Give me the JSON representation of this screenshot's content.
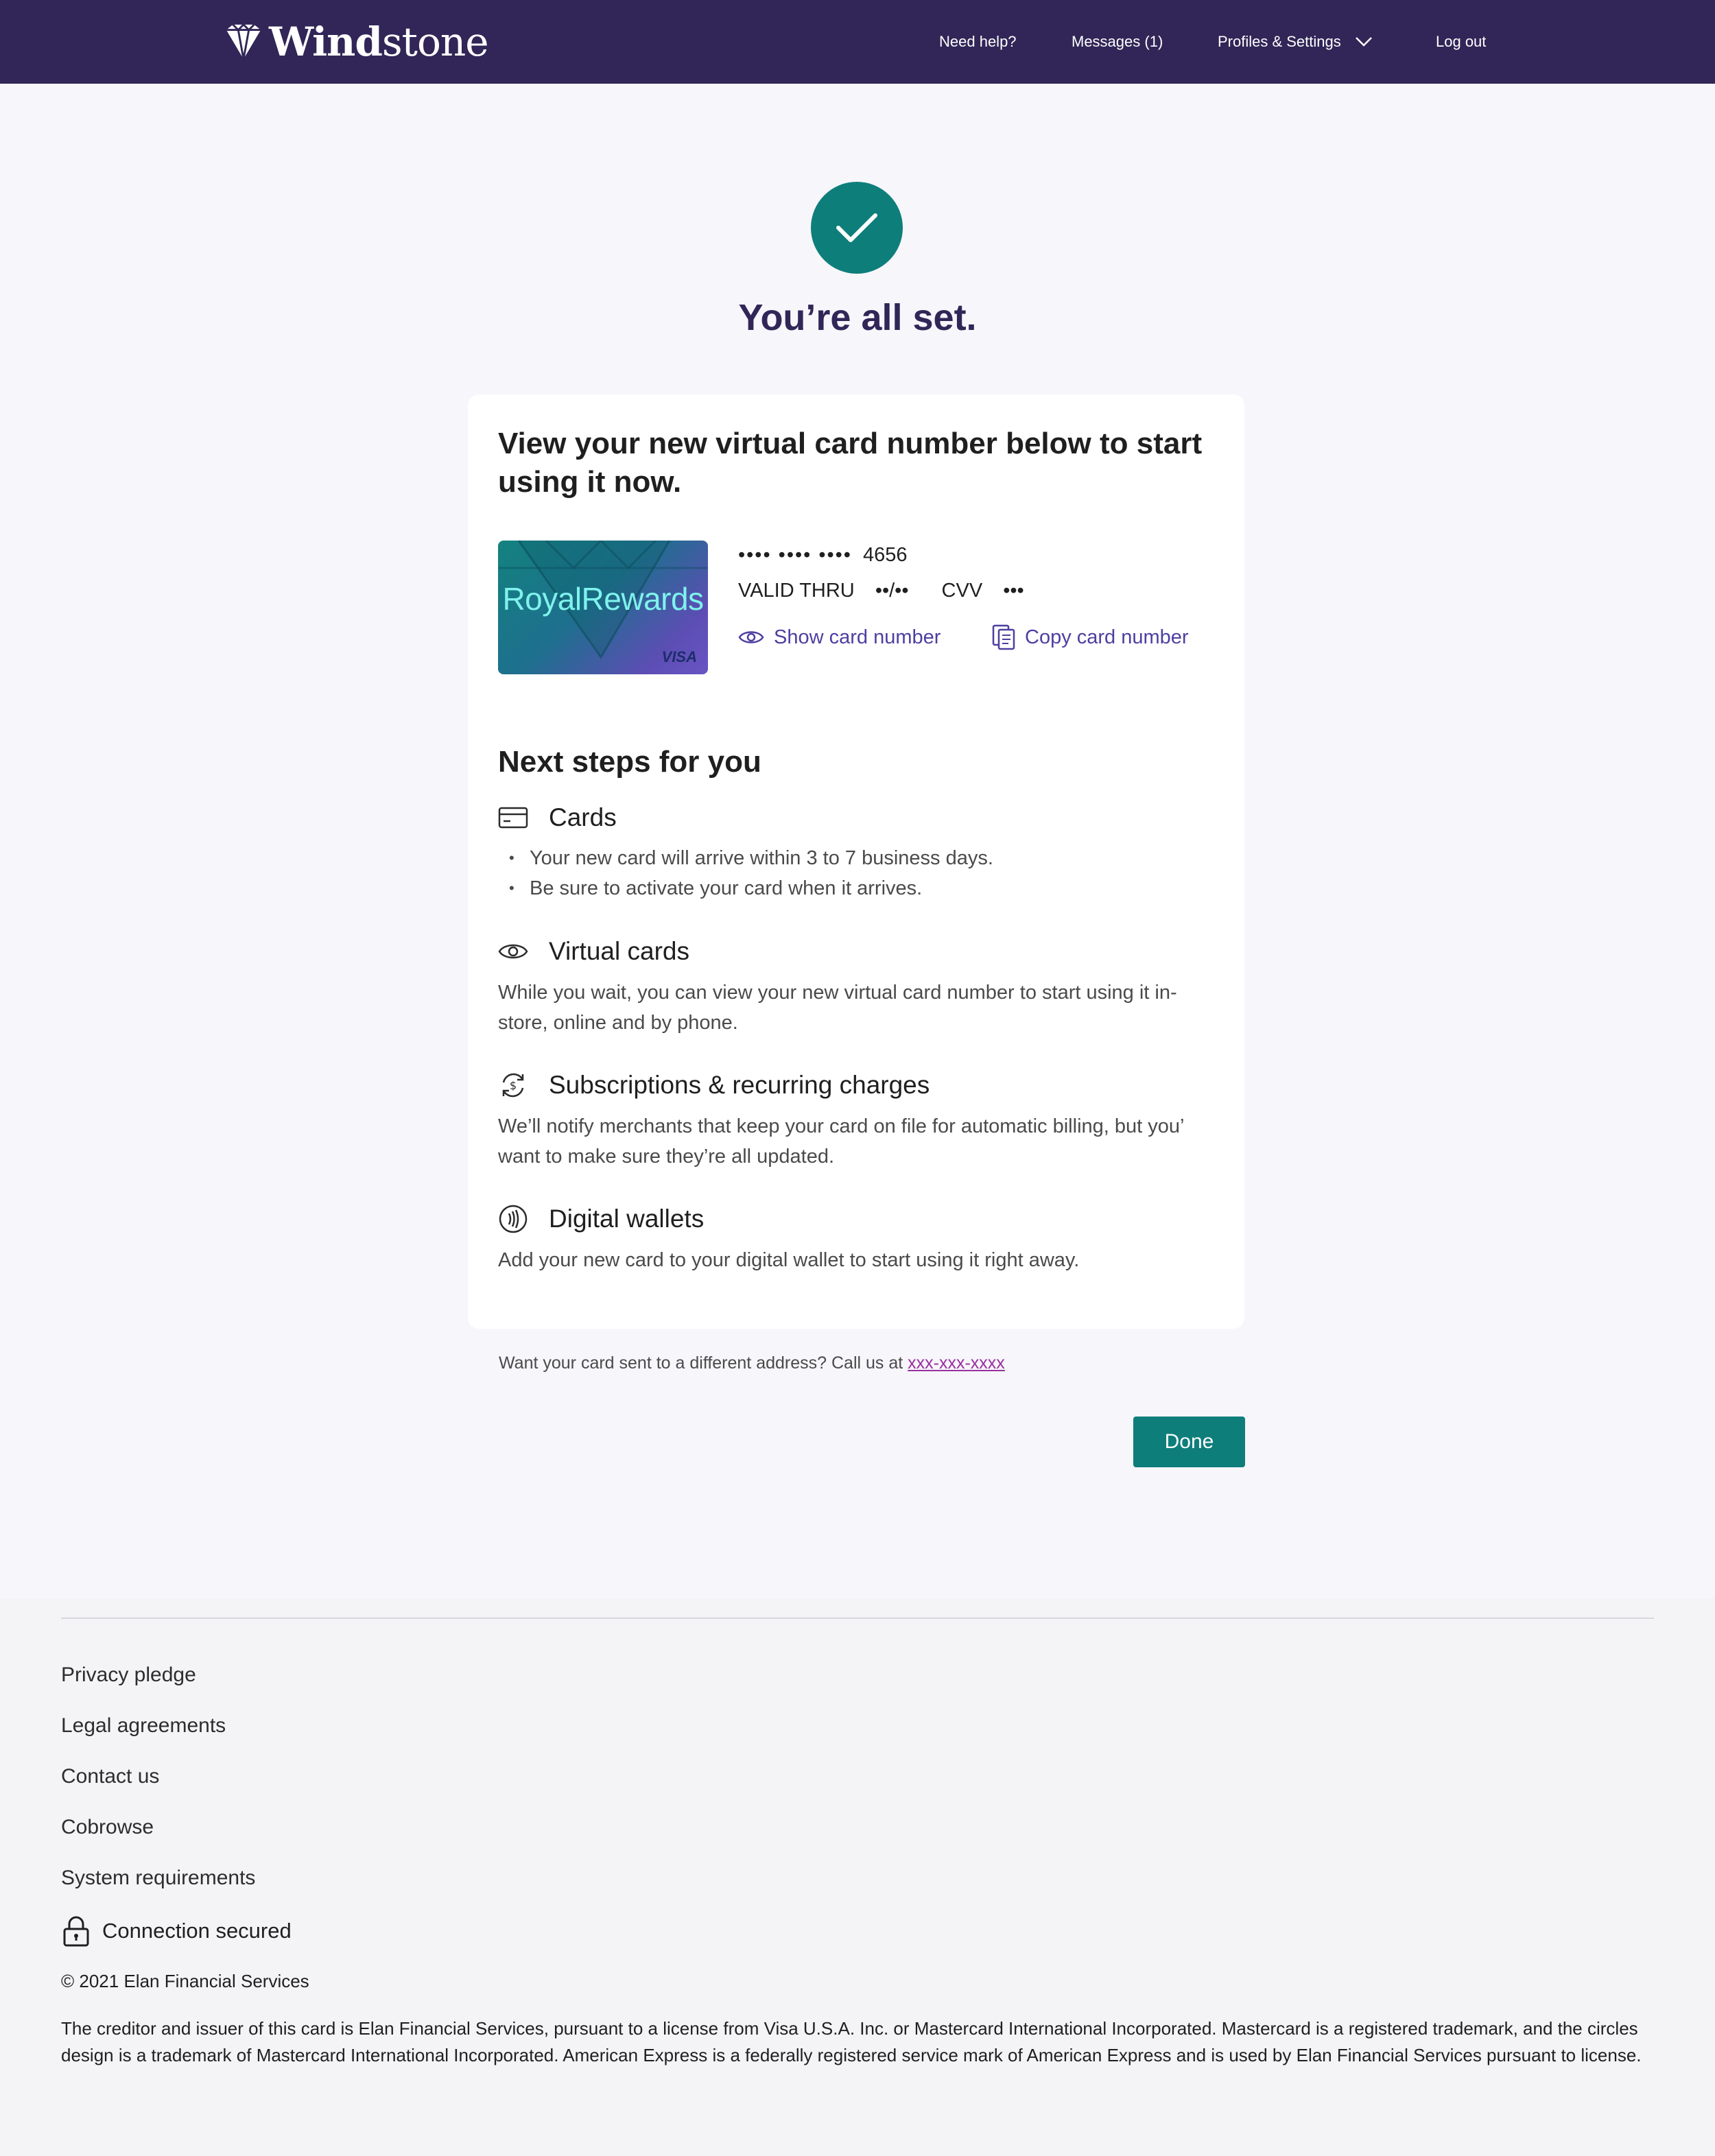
{
  "header": {
    "brand_bold": "Wind",
    "brand_light": "stone",
    "nav": {
      "help": "Need help?",
      "messages": "Messages (1)",
      "profiles": "Profiles & Settings",
      "logout": "Log out"
    }
  },
  "success": {
    "title": "You’re all set."
  },
  "card": {
    "heading": "View your new virtual card number below to start using it now.",
    "art_brand": "RoyalRewards",
    "art_network": "VISA",
    "masked_number": "•••• •••• ••••",
    "last_four": "4656",
    "valid_label": "VALID THRU",
    "valid_value": "••/••",
    "cvv_label": "CVV",
    "cvv_value": "•••",
    "show_link": "Show card number",
    "copy_link": "Copy card number"
  },
  "next_steps": {
    "title": "Next steps for you",
    "cards": {
      "heading": "Cards",
      "bullets": [
        "Your new card will arrive within 3 to 7 business days.",
        "Be sure to activate your card when it arrives."
      ]
    },
    "virtual": {
      "heading": "Virtual cards",
      "text": "While you wait, you can view your new virtual card number to start using it in-store, online and by phone."
    },
    "subscriptions": {
      "heading": "Subscriptions & recurring charges",
      "text": "We’ll notify merchants that keep your card on file for automatic billing, but you’ want to make sure they’re all updated."
    },
    "wallets": {
      "heading": "Digital wallets",
      "text": "Add your new card to your digital wallet to start using it right away."
    }
  },
  "address_note": {
    "text": "Want your card sent to a different address? Call us at",
    "phone": "xxx-xxx-xxxx"
  },
  "done_label": "Done",
  "footer": {
    "links": [
      "Privacy pledge",
      "Legal agreements",
      "Contact us",
      "Cobrowse",
      "System requirements"
    ],
    "secure": "Connection secured",
    "copyright": "© 2021 Elan Financial Services",
    "legal": "The creditor and issuer of this card is Elan Financial Services, pursuant to a license from Visa U.S.A. Inc. or Mastercard International Incorporated. Mastercard is a registered trademark, and the circles design is a trademark of Mastercard International Incorporated. American Express is a federally registered service mark of American Express and is used by Elan Financial Services pursuant to license."
  },
  "colors": {
    "header_bg": "#312657",
    "accent_teal": "#0e7e7b",
    "link_purple": "#4d3fa1",
    "phone_link": "#9b2f9f"
  }
}
